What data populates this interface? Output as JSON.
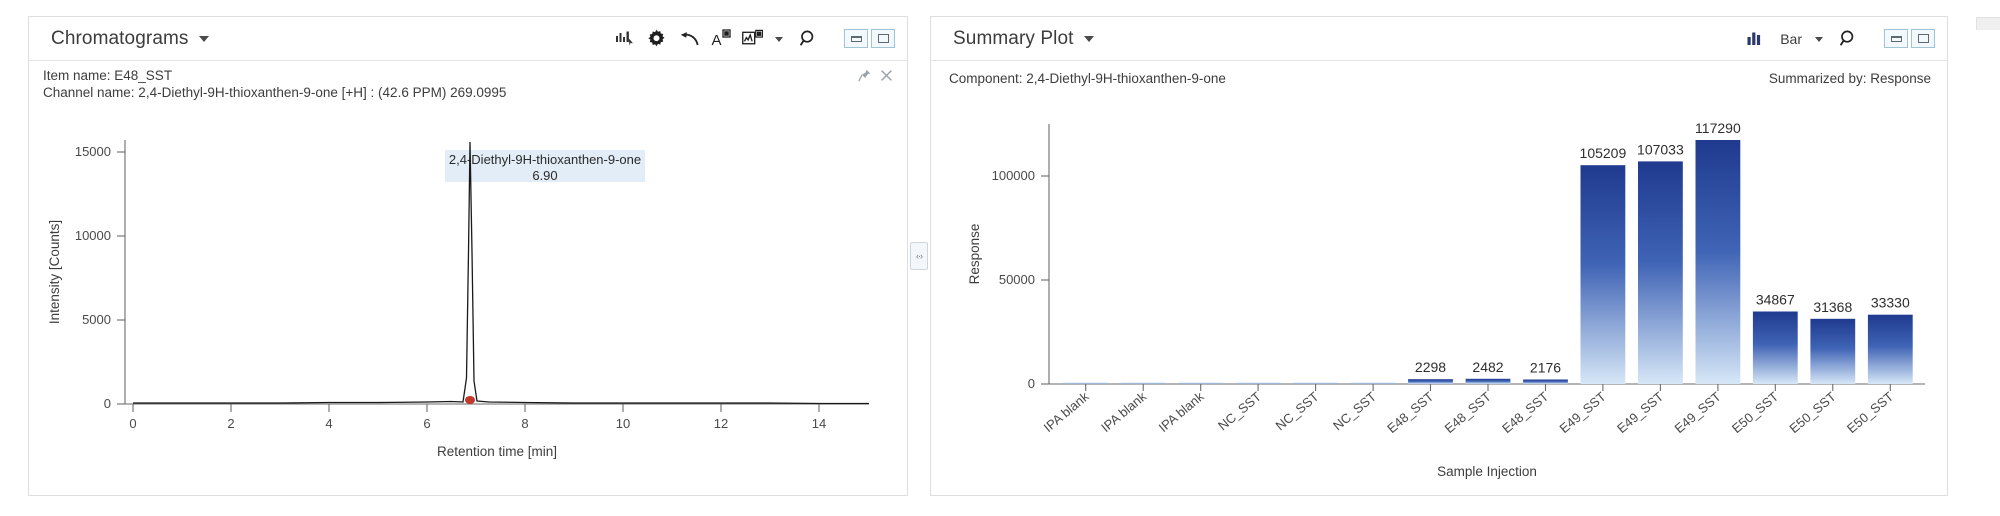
{
  "left_panel": {
    "title": "Chromatograms",
    "toolbar": {
      "icons": [
        "bar-cursor-icon",
        "gear-icon",
        "undo-icon",
        "annotate-a-icon",
        "trace-icon"
      ],
      "caret": "▾",
      "search": "search-icon",
      "restore_label": "Restore",
      "maximize_label": "Maximize"
    },
    "info": {
      "item_name": "Item name: E48_SST",
      "channel_name": "Channel name: 2,4-Diethyl-9H-thioxanthen-9-one [+H] : (42.6 PPM) 269.0995",
      "pin": "pin-icon",
      "close": "close-icon"
    },
    "chart_data": {
      "type": "line",
      "title": "",
      "xlabel": "Retention time [min]",
      "ylabel": "Intensity [Counts]",
      "xlim": [
        0,
        15
      ],
      "ylim": [
        -600,
        16200
      ],
      "xticks": [
        0,
        2,
        4,
        6,
        8,
        10,
        12,
        14
      ],
      "yticks": [
        0,
        5000,
        10000,
        15000
      ],
      "grid": false,
      "series": [
        {
          "name": "2,4-Diethyl-9H-thioxanthen-9-one",
          "color": "#1a1a1a",
          "x": [
            0,
            1,
            2,
            3,
            4,
            5,
            6,
            6.5,
            6.75,
            6.82,
            6.86,
            6.9,
            6.94,
            6.98,
            7.05,
            7.3,
            8,
            9,
            10,
            11,
            12,
            13,
            14,
            15
          ],
          "y": [
            40,
            40,
            45,
            45,
            50,
            50,
            55,
            60,
            120,
            1500,
            9000,
            15600,
            9000,
            1400,
            150,
            60,
            55,
            50,
            50,
            45,
            45,
            40,
            40,
            40
          ]
        }
      ],
      "annotations": [
        {
          "name": "peak-label",
          "text_line1": "2,4-Diethyl-9H-thioxanthen-9-one",
          "text_line2": "6.90",
          "x": 6.9,
          "y": 15600
        }
      ],
      "markers": [
        {
          "name": "peak-apex-marker",
          "x": 6.9,
          "y": 280,
          "color": "#c0392b"
        }
      ]
    }
  },
  "right_panel": {
    "title": "Summary Plot",
    "toolbar": {
      "chart_icon": "bar-chart-icon",
      "plot_type": "Bar",
      "caret": "▾",
      "search": "search-icon",
      "restore_label": "Restore",
      "maximize_label": "Maximize"
    },
    "info": {
      "component": "Component: 2,4-Diethyl-9H-thioxanthen-9-one",
      "summarized_by": "Summarized by: Response"
    },
    "chart_data": {
      "type": "bar",
      "title": "",
      "xlabel": "Sample Injection",
      "ylabel": "Response",
      "ylim": [
        0,
        130000
      ],
      "yticks": [
        0,
        50000,
        100000
      ],
      "grid": false,
      "categories": [
        "IPA blank",
        "IPA blank",
        "IPA blank",
        "NC_SST",
        "NC_SST",
        "NC_SST",
        "E48_SST",
        "E48_SST",
        "E48_SST",
        "E49_SST",
        "E49_SST",
        "E49_SST",
        "E50_SST",
        "E50_SST",
        "E50_SST"
      ],
      "values": [
        0,
        0,
        0,
        0,
        0,
        0,
        2298,
        2482,
        2176,
        105209,
        107033,
        117290,
        34867,
        31368,
        33330
      ],
      "value_labels": [
        "",
        "",
        "",
        "",
        "",
        "",
        "2298",
        "2482",
        "2176",
        "105209",
        "107033",
        "117290",
        "34867",
        "31368",
        "33330"
      ],
      "bar_gradient_top": "#243c8f",
      "bar_gradient_bottom": "#cfe3f5"
    }
  },
  "splitter": {
    "grip": "‹·›"
  }
}
